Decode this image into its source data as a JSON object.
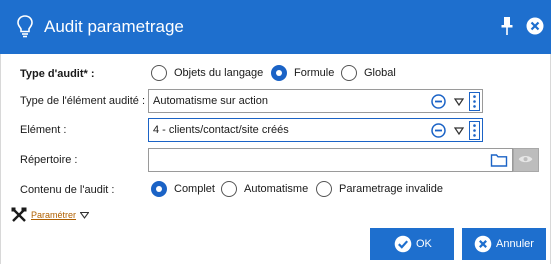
{
  "window": {
    "title": "Audit parametrage",
    "accent": "#1e6fce"
  },
  "audit_type": {
    "label": "Type d'audit* :",
    "options": [
      "Objets du langage",
      "Formule",
      "Global"
    ],
    "selected": "Formule"
  },
  "element_type": {
    "label": "Type de l'élément audité :",
    "value": "Automatisme sur action"
  },
  "element": {
    "label": "Elément :",
    "value": "4 - clients/contact/site créés"
  },
  "repertoire": {
    "label": "Répertoire :",
    "value": ""
  },
  "contenu": {
    "label": "Contenu de l'audit :",
    "options": [
      "Complet",
      "Automatisme",
      "Parametrage invalide"
    ],
    "selected": "Complet"
  },
  "parametrer": {
    "label": "Paramétrer"
  },
  "buttons": {
    "ok": "OK",
    "cancel": "Annuler"
  }
}
